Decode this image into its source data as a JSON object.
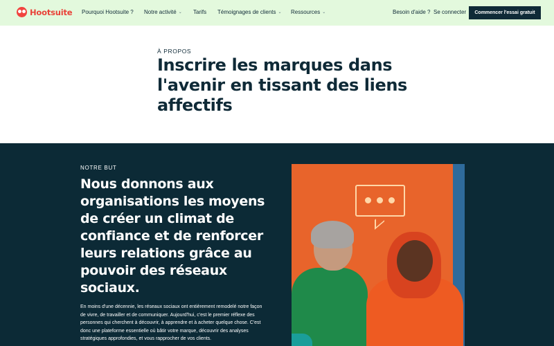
{
  "nav": {
    "logo": "Hootsuite",
    "items": [
      {
        "label": "Pourquoi Hootsuite ?",
        "dropdown": false
      },
      {
        "label": "Notre activité",
        "dropdown": true
      },
      {
        "label": "Tarifs",
        "dropdown": false
      },
      {
        "label": "Témoignages de clients",
        "dropdown": true
      },
      {
        "label": "Ressources",
        "dropdown": true
      }
    ],
    "help": "Besoin d'aide ?",
    "login": "Se connecter",
    "cta": "Commencer l'essai gratuit"
  },
  "hero": {
    "eyebrow": "À PROPOS",
    "title": "Inscrire les marques dans l'avenir en tissant des liens affectifs"
  },
  "mission": {
    "eyebrow": "NOTRE BUT",
    "title": "Nous donnons aux organisations les moyens de créer un climat de confiance et de renforcer leurs relations grâce au pouvoir des réseaux sociaux.",
    "body": "En moins d'une décennie, les réseaux sociaux ont entièrement remodelé notre façon de vivre, de travailler et de communiquer. Aujourd'hui, c'est le premier réflexe des personnes qui cherchent à découvrir, à apprendre et à acheter quelque chose. C'est donc une plateforme essentielle où bâtir votre marque, découvrir des analyses stratégiques approfondies, et vous rapprocher de vos clients."
  },
  "colors": {
    "nav_bg": "#e3f9dd",
    "brand": "#e94339",
    "dark_bg": "#0c2a36",
    "photo_bg": "#e8642b"
  }
}
